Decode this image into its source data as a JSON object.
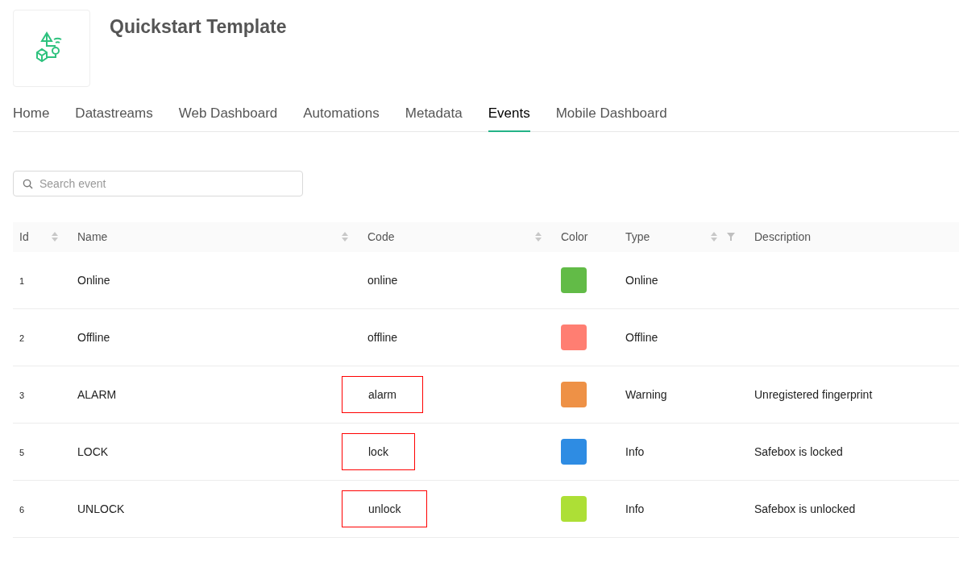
{
  "template": {
    "title": "Quickstart Template"
  },
  "tabs": [
    {
      "label": "Home",
      "selected": false
    },
    {
      "label": "Datastreams",
      "selected": false
    },
    {
      "label": "Web Dashboard",
      "selected": false
    },
    {
      "label": "Automations",
      "selected": false
    },
    {
      "label": "Metadata",
      "selected": false
    },
    {
      "label": "Events",
      "selected": true
    },
    {
      "label": "Mobile Dashboard",
      "selected": false
    }
  ],
  "search": {
    "placeholder": "Search event"
  },
  "table": {
    "columns": [
      {
        "label": "Id",
        "sortable": true,
        "filterable": false
      },
      {
        "label": "Name",
        "sortable": true,
        "filterable": false
      },
      {
        "label": "Code",
        "sortable": true,
        "filterable": false
      },
      {
        "label": "Color",
        "sortable": false,
        "filterable": false
      },
      {
        "label": "Type",
        "sortable": true,
        "filterable": true
      },
      {
        "label": "Description",
        "sortable": false,
        "filterable": false
      }
    ],
    "rows": [
      {
        "id": "1",
        "name": "Online",
        "code": "online",
        "color": "#62bb47",
        "type": "Online",
        "description": "",
        "highlighted": false
      },
      {
        "id": "2",
        "name": "Offline",
        "code": "offline",
        "color": "#ff7e72",
        "type": "Offline",
        "description": "",
        "highlighted": false
      },
      {
        "id": "3",
        "name": "ALARM",
        "code": "alarm",
        "color": "#ee9146",
        "type": "Warning",
        "description": "Unregistered fingerprint",
        "highlighted": true
      },
      {
        "id": "5",
        "name": "LOCK",
        "code": "lock",
        "color": "#2e8ce3",
        "type": "Info",
        "description": "Safebox is locked",
        "highlighted": true
      },
      {
        "id": "6",
        "name": "UNLOCK",
        "code": "unlock",
        "color": "#addf36",
        "type": "Info",
        "description": "Safebox is unlocked",
        "highlighted": true
      }
    ]
  }
}
